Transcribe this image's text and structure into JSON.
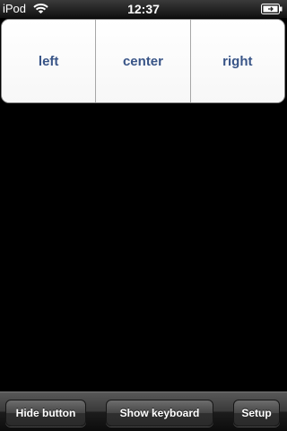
{
  "status_bar": {
    "carrier": "iPod",
    "time": "12:37",
    "icons": [
      "wifi-icon",
      "battery-icon"
    ]
  },
  "segmented_control": {
    "segments": [
      "left",
      "center",
      "right"
    ],
    "text_color": "#385487"
  },
  "toolbar": {
    "buttons": [
      "Hide button",
      "Show keyboard",
      "Setup"
    ]
  }
}
